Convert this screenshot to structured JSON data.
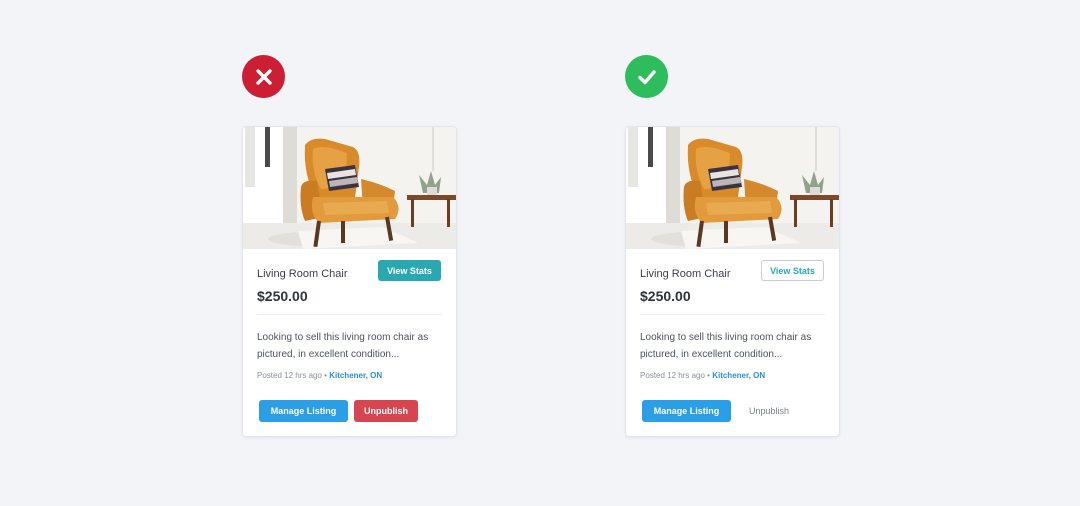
{
  "colors": {
    "background": "#f3f4f8",
    "bad_badge": "#cc1f33",
    "good_badge": "#2ebd5c",
    "teal": "#2aa8b2",
    "primary_blue": "#2b9fe6",
    "danger_red": "#d64550",
    "location_blue": "#2a8fd6"
  },
  "bad_example": {
    "badge_icon": "x-icon",
    "card": {
      "title": "Living Room Chair",
      "price": "$250.00",
      "stats_label": "View Stats",
      "description": "Looking to sell this living room chair as pictured, in excellent condition...",
      "posted": "Posted 12 hrs ago",
      "separator": " • ",
      "location": "Kitchener, ON",
      "manage_label": "Manage Listing",
      "unpublish_label": "Unpublish"
    }
  },
  "good_example": {
    "badge_icon": "checkmark-icon",
    "card": {
      "title": "Living Room Chair",
      "price": "$250.00",
      "stats_label": "View Stats",
      "description": "Looking to sell this living room chair as pictured, in excellent condition...",
      "posted": "Posted 12 hrs ago",
      "separator": " • ",
      "location": "Kitchener, ON",
      "manage_label": "Manage Listing",
      "unpublish_label": "Unpublish"
    }
  }
}
